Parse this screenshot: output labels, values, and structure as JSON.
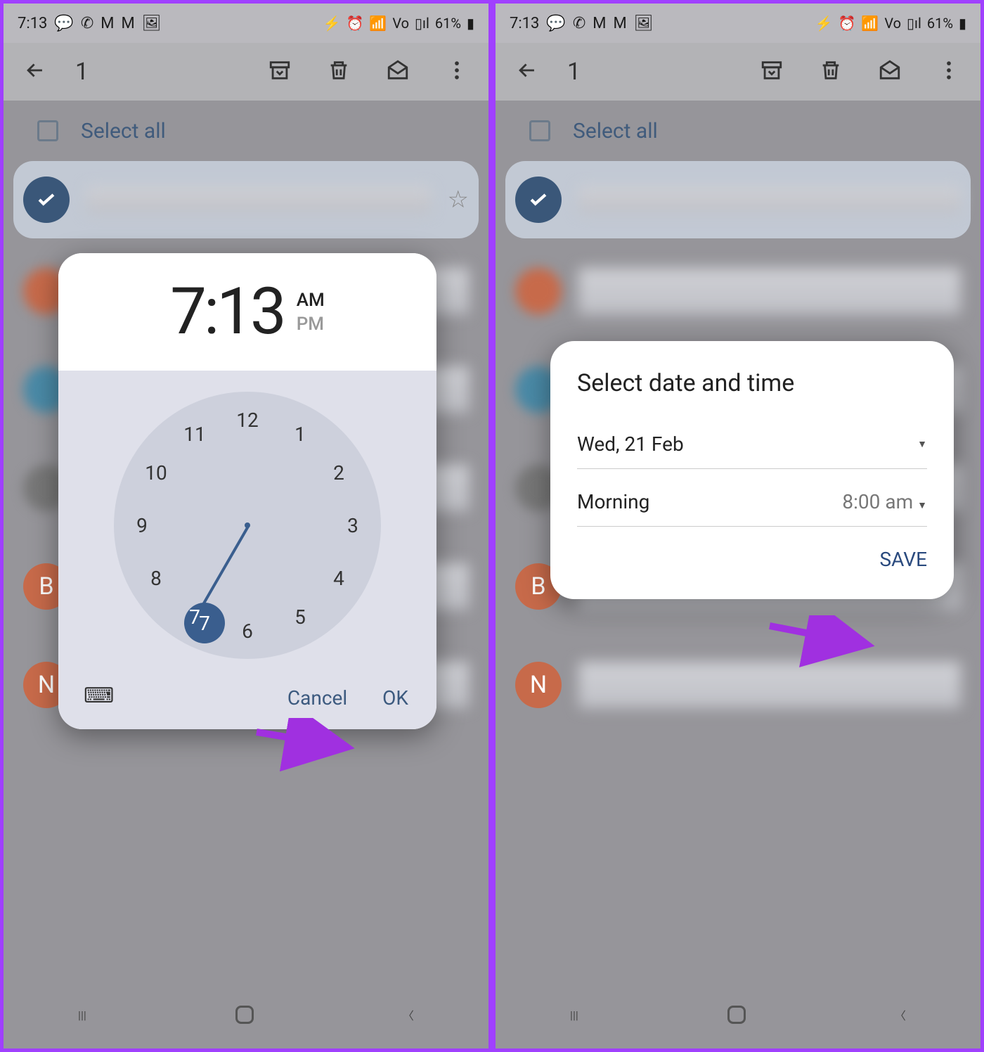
{
  "status": {
    "time": "7:13",
    "battery": "61%",
    "lte": "LTE",
    "volte": "Vo"
  },
  "appbar": {
    "count": "1"
  },
  "select_all": {
    "label": "Select all"
  },
  "avatars": {
    "b": "B",
    "n": "N"
  },
  "timepicker": {
    "hour": "7",
    "colon": ":",
    "minute": "13",
    "am": "AM",
    "pm": "PM",
    "am_active": true,
    "numbers": [
      "12",
      "1",
      "2",
      "3",
      "4",
      "5",
      "6",
      "7",
      "8",
      "9",
      "10",
      "11"
    ],
    "selected_hour": "7",
    "cancel": "Cancel",
    "ok": "OK"
  },
  "dtpicker": {
    "title": "Select date and time",
    "date": "Wed, 21 Feb",
    "time_label": "Morning",
    "time_value": "8:00 am",
    "save": "SAVE"
  }
}
